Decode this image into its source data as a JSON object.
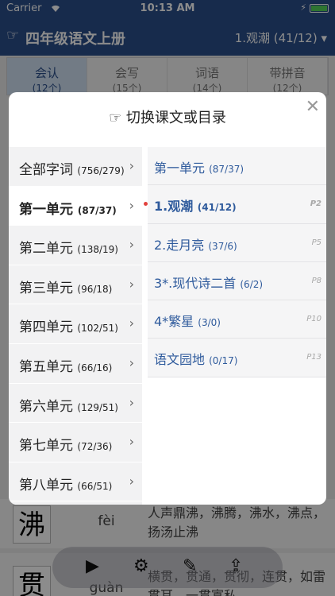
{
  "status": {
    "carrier": "Carrier",
    "time": "10:13 AM"
  },
  "navbar": {
    "title": "四年级语文上册",
    "current": "1.观潮 (41/12) ▾"
  },
  "tabs": [
    {
      "label": "会认",
      "sub": "(12个)"
    },
    {
      "label": "会写",
      "sub": "(15个)"
    },
    {
      "label": "词语",
      "sub": "(14个)"
    },
    {
      "label": "带拼音",
      "sub": "(12个)"
    }
  ],
  "background_rows": [
    {
      "char": "沸",
      "pinyin": "fèi",
      "words": "人声鼎沸，沸腾，沸水，沸点，扬汤止沸"
    },
    {
      "char": "贯",
      "pinyin": "guàn",
      "words": "横贯，贯通，贯彻，连贯，如雷贯耳，一贯寡私"
    }
  ],
  "modal": {
    "title": "切换课文或目录",
    "close": "✕",
    "units": [
      {
        "name": "全部字词",
        "count": "(756/279)"
      },
      {
        "name": "第一单元",
        "count": "(87/37)"
      },
      {
        "name": "第二单元",
        "count": "(138/19)"
      },
      {
        "name": "第三单元",
        "count": "(96/18)"
      },
      {
        "name": "第四单元",
        "count": "(102/51)"
      },
      {
        "name": "第五单元",
        "count": "(66/16)"
      },
      {
        "name": "第六单元",
        "count": "(129/51)"
      },
      {
        "name": "第七单元",
        "count": "(72/36)"
      },
      {
        "name": "第八单元",
        "count": "(66/51)"
      }
    ],
    "lessons": [
      {
        "name": "第一单元",
        "count": "(87/37)",
        "page": ""
      },
      {
        "name": "1.观潮",
        "count": "(41/12)",
        "page": "P2"
      },
      {
        "name": "2.走月亮",
        "count": "(37/6)",
        "page": "P5"
      },
      {
        "name": "3*.现代诗二首",
        "count": "(6/2)",
        "page": "P8"
      },
      {
        "name": "4*繁星",
        "count": "(3/0)",
        "page": "P10"
      },
      {
        "name": "语文园地",
        "count": "(0/17)",
        "page": "P13"
      }
    ]
  }
}
